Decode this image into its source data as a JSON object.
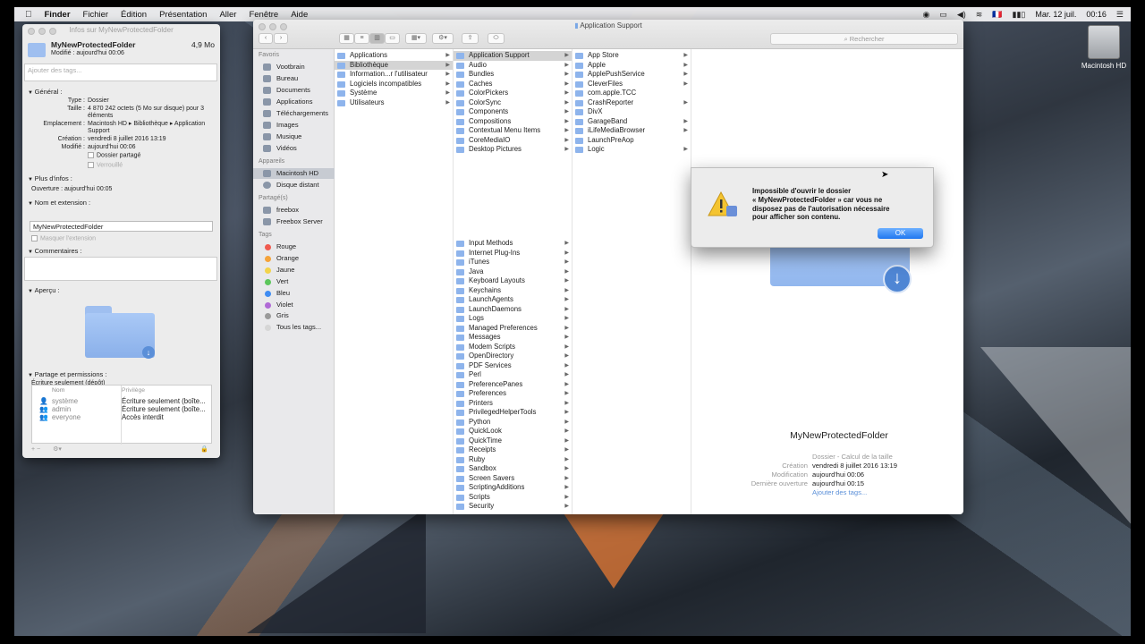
{
  "menubar": {
    "apple_icon": "apple-icon",
    "items": [
      "Finder",
      "Fichier",
      "Édition",
      "Présentation",
      "Aller",
      "Fenêtre",
      "Aide"
    ],
    "flag": "🇫🇷",
    "date": "Mar. 12 juil.",
    "time": "00:16"
  },
  "desktop": {
    "disk_label": "Macintosh HD"
  },
  "info_window": {
    "title": "Infos sur MyNewProtectedFolder",
    "folder_name": "MyNewProtectedFolder",
    "size_short": "4,9 Mo",
    "modified_line": "Modifié :  aujourd'hui 00:06",
    "tags_placeholder": "Ajouter des tags...",
    "general_header": "Général :",
    "general": {
      "type_k": "Type :",
      "type_v": "Dossier",
      "size_k": "Taille :",
      "size_v": "4 870 242 octets (5 Mo sur disque) pour 3 éléments",
      "loc_k": "Emplacement :",
      "loc_v": "Macintosh HD ▸ Bibliothèque ▸ Application Support",
      "created_k": "Création :",
      "created_v": "vendredi 8 juillet 2016 13:19",
      "modified_k": "Modifié :",
      "modified_v": "aujourd'hui 00:06",
      "shared": "Dossier partagé",
      "locked": "Verrouillé"
    },
    "more_header": "Plus d'infos :",
    "last_open": "Ouverture :  aujourd'hui 00:05",
    "name_header": "Nom et extension :",
    "name_value": "MyNewProtectedFolder",
    "hide_ext": "Masquer l'extension",
    "comments_header": "Commentaires :",
    "preview_header": "Aperçu :",
    "perm_header": "Partage et permissions :",
    "perm_status": "Écriture seulement (dépôt)",
    "perm_cols": [
      "Nom",
      "Privilège"
    ],
    "perm_rows": [
      {
        "name": "système",
        "priv": "Écriture seulement (boîte..."
      },
      {
        "name": "admin",
        "priv": "Écriture seulement (boîte..."
      },
      {
        "name": "everyone",
        "priv": "Accès interdit"
      }
    ]
  },
  "finder": {
    "title": "Application Support",
    "search_placeholder": "Rechercher",
    "sidebar": {
      "favorites_header": "Favoris",
      "favorites": [
        "Vootbrain",
        "Bureau",
        "Documents",
        "Applications",
        "Téléchargements",
        "Images",
        "Musique",
        "Vidéos"
      ],
      "devices_header": "Appareils",
      "devices": [
        "Macintosh HD",
        "Disque distant"
      ],
      "shared_header": "Partagé(s)",
      "shared": [
        "freebox",
        "Freebox Server"
      ],
      "tags_header": "Tags",
      "tags": [
        {
          "label": "Rouge",
          "color": "#f05a4f"
        },
        {
          "label": "Orange",
          "color": "#f5a33a"
        },
        {
          "label": "Jaune",
          "color": "#f2d34b"
        },
        {
          "label": "Vert",
          "color": "#5cc65b"
        },
        {
          "label": "Bleu",
          "color": "#3f8cf2"
        },
        {
          "label": "Violet",
          "color": "#b06ad6"
        },
        {
          "label": "Gris",
          "color": "#9a9a9a"
        },
        {
          "label": "Tous les tags...",
          "color": "#d6d6d6"
        }
      ]
    },
    "col1": [
      "Applications",
      "Bibliothèque",
      "Information...r l'utilisateur",
      "Logiciels incompatibles",
      "Système",
      "Utilisateurs"
    ],
    "col2_top": [
      "Application Support",
      "Audio",
      "Bundles",
      "Caches",
      "ColorPickers",
      "ColorSync",
      "Components",
      "Compositions",
      "Contextual Menu Items",
      "CoreMediaIO",
      "Desktop Pictures"
    ],
    "col2_bottom": [
      "Input Methods",
      "Internet Plug-Ins",
      "iTunes",
      "Java",
      "Keyboard Layouts",
      "Keychains",
      "LaunchAgents",
      "LaunchDaemons",
      "Logs",
      "Managed Preferences",
      "Messages",
      "Modem Scripts",
      "OpenDirectory",
      "PDF Services",
      "Perl",
      "PreferencePanes",
      "Preferences",
      "Printers",
      "PrivilegedHelperTools",
      "Python",
      "QuickLook",
      "QuickTime",
      "Receipts",
      "Ruby",
      "Sandbox",
      "Screen Savers",
      "ScriptingAdditions",
      "Scripts",
      "Security"
    ],
    "col3": [
      "App Store",
      "Apple",
      "ApplePushService",
      "CleverFiles",
      "com.apple.TCC",
      "CrashReporter",
      "DivX",
      "GarageBand",
      "iLifeMediaBrowser",
      "LaunchPreAop",
      "Logic"
    ],
    "preview": {
      "name": "MyNewProtectedFolder",
      "kind": "Dossier - Calcul de la taille",
      "created_k": "Création",
      "created_v": "vendredi 8 juillet 2016 13:19",
      "modified_k": "Modification",
      "modified_v": "aujourd'hui 00:06",
      "opened_k": "Dernière ouverture",
      "opened_v": "aujourd'hui 00:15",
      "add_tags": "Ajouter des tags..."
    }
  },
  "alert": {
    "line1": "Impossible d'ouvrir le dossier",
    "line2": "« MyNewProtectedFolder » car vous ne",
    "line3": "disposez pas de l'autorisation nécessaire",
    "line4": "pour afficher son contenu.",
    "ok": "OK"
  }
}
